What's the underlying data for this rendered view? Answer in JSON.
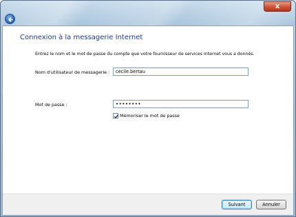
{
  "window": {
    "close_label": "x"
  },
  "page": {
    "heading": "Connexion à la messagerie Internet",
    "instruction": "Entrez le nom et le mot de passe du compte que votre fournisseur de services Internet vous a donnés."
  },
  "form": {
    "username_label": "Nom d'utilisateur de messagerie :",
    "username_value": "cecile.bertau",
    "password_label": "Mot de passe :",
    "password_value": "••••••••",
    "remember_label": "Mémoriser le mot de passe",
    "remember_checked": true
  },
  "footer": {
    "next_label": "Suivant",
    "cancel_label": "Annuler"
  },
  "icons": {
    "back": "back-arrow-icon",
    "close": "close-icon",
    "check": "checkmark-icon"
  }
}
